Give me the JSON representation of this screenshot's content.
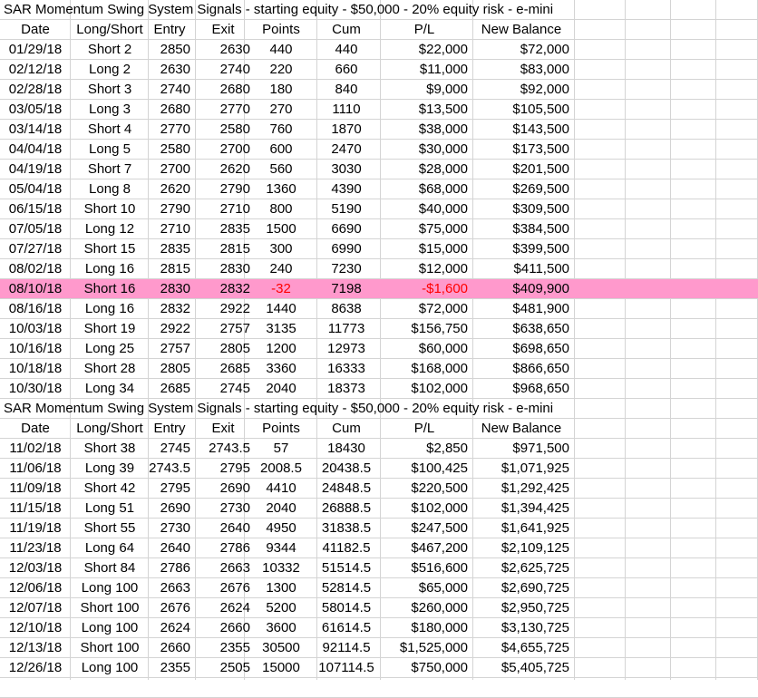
{
  "tables": [
    {
      "title": "SAR Momentum Swing System Signals - starting equity - $50,000 - 20% equity risk - e-mini",
      "headers": [
        "Date",
        "Long/Short",
        "Entry",
        "Exit",
        "Points",
        "Cum",
        "P/L",
        "New Balance"
      ],
      "rows": [
        [
          "01/29/18",
          "Short 2",
          "2850",
          "2630",
          "440",
          "440",
          "$22,000",
          "$72,000"
        ],
        [
          "02/12/18",
          "Long 2",
          "2630",
          "2740",
          "220",
          "660",
          "$11,000",
          "$83,000"
        ],
        [
          "02/28/18",
          "Short 3",
          "2740",
          "2680",
          "180",
          "840",
          "$9,000",
          "$92,000"
        ],
        [
          "03/05/18",
          "Long 3",
          "2680",
          "2770",
          "270",
          "1110",
          "$13,500",
          "$105,500"
        ],
        [
          "03/14/18",
          "Short 4",
          "2770",
          "2580",
          "760",
          "1870",
          "$38,000",
          "$143,500"
        ],
        [
          "04/04/18",
          "Long 5",
          "2580",
          "2700",
          "600",
          "2470",
          "$30,000",
          "$173,500"
        ],
        [
          "04/19/18",
          "Short 7",
          "2700",
          "2620",
          "560",
          "3030",
          "$28,000",
          "$201,500"
        ],
        [
          "05/04/18",
          "Long 8",
          "2620",
          "2790",
          "1360",
          "4390",
          "$68,000",
          "$269,500"
        ],
        [
          "06/15/18",
          "Short 10",
          "2790",
          "2710",
          "800",
          "5190",
          "$40,000",
          "$309,500"
        ],
        [
          "07/05/18",
          "Long 12",
          "2710",
          "2835",
          "1500",
          "6690",
          "$75,000",
          "$384,500"
        ],
        [
          "07/27/18",
          "Short 15",
          "2835",
          "2815",
          "300",
          "6990",
          "$15,000",
          "$399,500"
        ],
        [
          "08/02/18",
          "Long 16",
          "2815",
          "2830",
          "240",
          "7230",
          "$12,000",
          "$411,500"
        ],
        [
          "08/10/18",
          "Short 16",
          "2830",
          "2832",
          "-32",
          "7198",
          "-$1,600",
          "$409,900"
        ],
        [
          "08/16/18",
          "Long 16",
          "2832",
          "2922",
          "1440",
          "8638",
          "$72,000",
          "$481,900"
        ],
        [
          "10/03/18",
          "Short 19",
          "2922",
          "2757",
          "3135",
          "11773",
          "$156,750",
          "$638,650"
        ],
        [
          "10/16/18",
          "Long 25",
          "2757",
          "2805",
          "1200",
          "12973",
          "$60,000",
          "$698,650"
        ],
        [
          "10/18/18",
          "Short 28",
          "2805",
          "2685",
          "3360",
          "16333",
          "$168,000",
          "$866,650"
        ],
        [
          "10/30/18",
          "Long 34",
          "2685",
          "2745",
          "2040",
          "18373",
          "$102,000",
          "$968,650"
        ]
      ]
    },
    {
      "title": "SAR Momentum Swing System Signals - starting equity - $50,000 - 20% equity risk - e-mini",
      "headers": [
        "Date",
        "Long/Short",
        "Entry",
        "Exit",
        "Points",
        "Cum",
        "P/L",
        "New Balance"
      ],
      "rows": [
        [
          "11/02/18",
          "Short 38",
          "2745",
          "2743.5",
          "57",
          "18430",
          "$2,850",
          "$971,500"
        ],
        [
          "11/06/18",
          "Long 39",
          "2743.5",
          "2795",
          "2008.5",
          "20438.5",
          "$100,425",
          "$1,071,925"
        ],
        [
          "11/09/18",
          "Short 42",
          "2795",
          "2690",
          "4410",
          "24848.5",
          "$220,500",
          "$1,292,425"
        ],
        [
          "11/15/18",
          "Long 51",
          "2690",
          "2730",
          "2040",
          "26888.5",
          "$102,000",
          "$1,394,425"
        ],
        [
          "11/19/18",
          "Short 55",
          "2730",
          "2640",
          "4950",
          "31838.5",
          "$247,500",
          "$1,641,925"
        ],
        [
          "11/23/18",
          "Long 64",
          "2640",
          "2786",
          "9344",
          "41182.5",
          "$467,200",
          "$2,109,125"
        ],
        [
          "12/03/18",
          "Short 84",
          "2786",
          "2663",
          "10332",
          "51514.5",
          "$516,600",
          "$2,625,725"
        ],
        [
          "12/06/18",
          "Long 100",
          "2663",
          "2676",
          "1300",
          "52814.5",
          "$65,000",
          "$2,690,725"
        ],
        [
          "12/07/18",
          "Short 100",
          "2676",
          "2624",
          "5200",
          "58014.5",
          "$260,000",
          "$2,950,725"
        ],
        [
          "12/10/18",
          "Long 100",
          "2624",
          "2660",
          "3600",
          "61614.5",
          "$180,000",
          "$3,130,725"
        ],
        [
          "12/13/18",
          "Short 100",
          "2660",
          "2355",
          "30500",
          "92114.5",
          "$1,525,000",
          "$4,655,725"
        ],
        [
          "12/26/18",
          "Long 100",
          "2355",
          "2505",
          "15000",
          "107114.5",
          "$750,000",
          "$5,405,725"
        ]
      ]
    }
  ],
  "colors": {
    "highlight_row": "#ff99cc",
    "negative": "#ff0000",
    "gridline": "#d4d4d4"
  }
}
